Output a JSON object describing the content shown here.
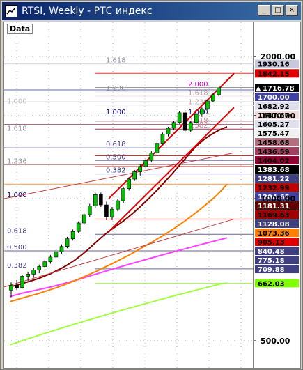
{
  "window": {
    "title": "RTSI, Weekly - РТС индекс",
    "minimize_label": "_",
    "maximize_label": "□",
    "close_label": "×"
  },
  "chart_data": {
    "type": "candlestick",
    "panel_label": "Data",
    "yscale": "log",
    "ylim": [
      450,
      2300
    ],
    "axis_ticks": [
      {
        "label": "2000.00",
        "value": 2000
      },
      {
        "label": "1500.00",
        "value": 1500
      },
      {
        "label": "1000.00",
        "value": 1000
      },
      {
        "label": "500.00",
        "value": 500
      }
    ],
    "price_tags": [
      {
        "label": "1930.16",
        "value": 1930.16,
        "bg": "#c8c8dc",
        "fg": "#000000"
      },
      {
        "label": "1842.15",
        "value": 1842.15,
        "bg": "#e00000",
        "fg": "#000000"
      },
      {
        "label": "1716.78",
        "value": 1716.78,
        "bg": "#000000",
        "fg": "#ffffff",
        "arrow": true
      },
      {
        "label": "1700.00",
        "value": 1700.0,
        "bg": "#4040a0",
        "fg": "#ffffff"
      },
      {
        "label": "1682.92",
        "value": 1682.92,
        "bg": "#e0e0ec",
        "fg": "#000000"
      },
      {
        "label": "1647.67",
        "value": 1647.67,
        "bg": "#f0dcdc",
        "fg": "#000000"
      },
      {
        "label": "1605.27",
        "value": 1605.27,
        "bg": "#e0e0ec",
        "fg": "#000000"
      },
      {
        "label": "1575.47",
        "value": 1575.47,
        "bg": "#f0f0f0",
        "fg": "#000000"
      },
      {
        "label": "1458.68",
        "value": 1458.68,
        "bg": "#b07080",
        "fg": "#000000"
      },
      {
        "label": "1436.59",
        "value": 1436.59,
        "bg": "#a04060",
        "fg": "#000000"
      },
      {
        "label": "1404.02",
        "value": 1404.02,
        "bg": "#900030",
        "fg": "#000000"
      },
      {
        "label": "1383.68",
        "value": 1383.68,
        "bg": "#000000",
        "fg": "#ffffff"
      },
      {
        "label": "1281.22",
        "value": 1281.22,
        "bg": "#404080",
        "fg": "#ffffff"
      },
      {
        "label": "1232.99",
        "value": 1232.99,
        "bg": "#c00000",
        "fg": "#000000"
      },
      {
        "label": "1204.65",
        "value": 1204.65,
        "bg": "#4040a0",
        "fg": "#ffffff"
      },
      {
        "label": "1181.31",
        "value": 1181.31,
        "bg": "#600000",
        "fg": "#ffffff"
      },
      {
        "label": "1169.63",
        "value": 1169.63,
        "bg": "#a00000",
        "fg": "#000000"
      },
      {
        "label": "1128.08",
        "value": 1128.08,
        "bg": "#404080",
        "fg": "#ffffff"
      },
      {
        "label": "1073.36",
        "value": 1073.36,
        "bg": "#ff8000",
        "fg": "#000000"
      },
      {
        "label": "905.13",
        "value": 905.13,
        "bg": "#e00000",
        "fg": "#000000"
      },
      {
        "label": "840.48",
        "value": 840.48,
        "bg": "#404080",
        "fg": "#ffffff"
      },
      {
        "label": "775.18",
        "value": 775.18,
        "bg": "#404080",
        "fg": "#ffffff"
      },
      {
        "label": "709.88",
        "value": 709.88,
        "bg": "#404080",
        "fg": "#ffffff"
      },
      {
        "label": "662.03",
        "value": 662.03,
        "bg": "#80ff00",
        "fg": "#000000"
      }
    ],
    "fib_labels": [
      {
        "label": "1.618",
        "value": 1930,
        "color": "#9090a0",
        "side": "upper"
      },
      {
        "label": "1.236",
        "value": 1682,
        "color": "#9090a0",
        "side": "upper"
      },
      {
        "label": "2.000",
        "value": 1716,
        "color": "#d000d0",
        "side": "upper2"
      },
      {
        "label": "1.618",
        "value": 1647,
        "color": "#c0a0a0",
        "side": "upper2"
      },
      {
        "label": "1.236",
        "value": 1575,
        "color": "#c0a0a0",
        "side": "upper2"
      },
      {
        "label": "1.000",
        "value": 1500,
        "color": "#000080",
        "side": "upper2"
      },
      {
        "label": "0.618",
        "value": 1438,
        "color": "#c08090",
        "side": "upper2"
      },
      {
        "label": "0.382",
        "value": 1404,
        "color": "#c08090",
        "side": "upper2"
      },
      {
        "label": "1.000",
        "value": 1580,
        "color": "#c0c0c0",
        "side": "left"
      },
      {
        "label": "1.000",
        "value": 1500,
        "color": "#000080",
        "side": "mid"
      },
      {
        "label": "1.618",
        "value": 1383,
        "color": "#9090a0",
        "side": "left"
      },
      {
        "label": "0.618",
        "value": 1281,
        "color": "#404080",
        "side": "mid"
      },
      {
        "label": "0.500",
        "value": 1204,
        "color": "#404080",
        "side": "mid"
      },
      {
        "label": "0.382",
        "value": 1128,
        "color": "#404080",
        "side": "mid"
      },
      {
        "label": "1.236",
        "value": 1180,
        "color": "#9090a0",
        "side": "left"
      },
      {
        "label": "1.000",
        "value": 1000,
        "color": "#000080",
        "side": "left"
      },
      {
        "label": "0.618",
        "value": 840,
        "color": "#404080",
        "side": "left"
      },
      {
        "label": "0.500",
        "value": 775,
        "color": "#404080",
        "side": "left"
      },
      {
        "label": "0.382",
        "value": 709,
        "color": "#404080",
        "side": "left"
      }
    ],
    "candles": [
      {
        "o": 640,
        "h": 665,
        "l": 618,
        "c": 655
      },
      {
        "o": 655,
        "h": 672,
        "l": 640,
        "c": 648
      },
      {
        "o": 648,
        "h": 690,
        "l": 645,
        "c": 685
      },
      {
        "o": 685,
        "h": 700,
        "l": 670,
        "c": 692
      },
      {
        "o": 692,
        "h": 712,
        "l": 680,
        "c": 706
      },
      {
        "o": 706,
        "h": 725,
        "l": 695,
        "c": 718
      },
      {
        "o": 718,
        "h": 742,
        "l": 712,
        "c": 735
      },
      {
        "o": 735,
        "h": 760,
        "l": 728,
        "c": 752
      },
      {
        "o": 752,
        "h": 780,
        "l": 745,
        "c": 772
      },
      {
        "o": 772,
        "h": 800,
        "l": 765,
        "c": 792
      },
      {
        "o": 792,
        "h": 830,
        "l": 785,
        "c": 822
      },
      {
        "o": 822,
        "h": 860,
        "l": 815,
        "c": 852
      },
      {
        "o": 852,
        "h": 895,
        "l": 845,
        "c": 888
      },
      {
        "o": 888,
        "h": 935,
        "l": 880,
        "c": 925
      },
      {
        "o": 925,
        "h": 975,
        "l": 915,
        "c": 965
      },
      {
        "o": 965,
        "h": 1030,
        "l": 955,
        "c": 1020
      },
      {
        "o": 1020,
        "h": 1030,
        "l": 960,
        "c": 970
      },
      {
        "o": 970,
        "h": 985,
        "l": 900,
        "c": 915
      },
      {
        "o": 915,
        "h": 960,
        "l": 900,
        "c": 950
      },
      {
        "o": 950,
        "h": 1000,
        "l": 940,
        "c": 990
      },
      {
        "o": 990,
        "h": 1060,
        "l": 980,
        "c": 1050
      },
      {
        "o": 1050,
        "h": 1110,
        "l": 1040,
        "c": 1100
      },
      {
        "o": 1100,
        "h": 1150,
        "l": 1090,
        "c": 1140
      },
      {
        "o": 1140,
        "h": 1180,
        "l": 1120,
        "c": 1170
      },
      {
        "o": 1170,
        "h": 1215,
        "l": 1160,
        "c": 1205
      },
      {
        "o": 1205,
        "h": 1260,
        "l": 1195,
        "c": 1250
      },
      {
        "o": 1250,
        "h": 1320,
        "l": 1240,
        "c": 1310
      },
      {
        "o": 1310,
        "h": 1380,
        "l": 1300,
        "c": 1370
      },
      {
        "o": 1370,
        "h": 1420,
        "l": 1355,
        "c": 1410
      },
      {
        "o": 1410,
        "h": 1460,
        "l": 1395,
        "c": 1450
      },
      {
        "o": 1450,
        "h": 1530,
        "l": 1440,
        "c": 1520
      },
      {
        "o": 1520,
        "h": 1540,
        "l": 1380,
        "c": 1395
      },
      {
        "o": 1395,
        "h": 1460,
        "l": 1385,
        "c": 1450
      },
      {
        "o": 1450,
        "h": 1520,
        "l": 1440,
        "c": 1510
      },
      {
        "o": 1510,
        "h": 1560,
        "l": 1490,
        "c": 1550
      },
      {
        "o": 1550,
        "h": 1620,
        "l": 1540,
        "c": 1610
      },
      {
        "o": 1610,
        "h": 1670,
        "l": 1600,
        "c": 1660
      },
      {
        "o": 1660,
        "h": 1720,
        "l": 1650,
        "c": 1716.78
      }
    ],
    "ma_series": [
      {
        "color": "#a0ff40",
        "values": [
          490,
          495,
          500,
          505,
          510,
          515,
          520,
          525,
          530,
          535,
          540,
          545,
          550,
          555,
          560,
          565,
          570,
          575,
          580,
          585,
          590,
          595,
          600,
          605,
          610,
          615,
          620,
          625,
          630,
          635,
          640,
          645,
          650,
          655,
          660,
          662
        ]
      },
      {
        "color": "#ff40ff",
        "values": [
          620,
          625,
          630,
          634,
          638,
          642,
          646,
          650,
          655,
          660,
          665,
          670,
          676,
          682,
          688,
          694,
          700,
          706,
          712,
          718,
          724,
          730,
          736,
          742,
          748,
          754,
          760,
          766,
          772,
          778,
          784,
          790,
          796,
          802,
          808,
          814,
          820,
          826
        ]
      },
      {
        "color": "#ff8000",
        "values": [
          605,
          610,
          615,
          620,
          625,
          630,
          636,
          642,
          648,
          655,
          662,
          670,
          678,
          686,
          695,
          704,
          714,
          724,
          734,
          745,
          756,
          768,
          780,
          793,
          806,
          820,
          834,
          849,
          865,
          882,
          900,
          920,
          940,
          962,
          985,
          1010,
          1040,
          1073
        ]
      },
      {
        "color": "#800000",
        "values": [
          650,
          655,
          660,
          666,
          672,
          678,
          686,
          694,
          704,
          714,
          726,
          740,
          756,
          774,
          794,
          815,
          836,
          855,
          872,
          890,
          910,
          932,
          956,
          982,
          1010,
          1040,
          1072,
          1106,
          1142,
          1180,
          1220,
          1262,
          1300,
          1332,
          1360,
          1383,
          1404,
          1420
        ]
      }
    ]
  }
}
